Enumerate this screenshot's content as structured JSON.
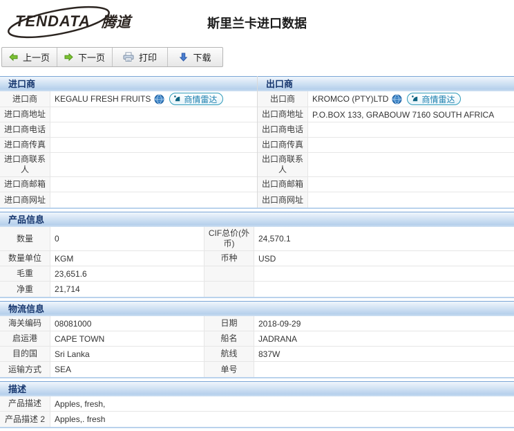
{
  "brand": {
    "logo_en": "TENDATA",
    "logo_cn": "腾道"
  },
  "page_title": "斯里兰卡进口数据",
  "toolbar": {
    "prev_label": "上一页",
    "next_label": "下一页",
    "print_label": "打印",
    "download_label": "下载"
  },
  "radar_button_label": "商情雷达",
  "importer": {
    "header": "进口商",
    "rows": [
      {
        "label": "进口商",
        "value": "KEGALU FRESH FRUITS"
      },
      {
        "label": "进口商地址",
        "value": ""
      },
      {
        "label": "进口商电话",
        "value": ""
      },
      {
        "label": "进口商传真",
        "value": ""
      },
      {
        "label": "进口商联系人",
        "value": ""
      },
      {
        "label": "进口商邮箱",
        "value": ""
      },
      {
        "label": "进口商网址",
        "value": ""
      }
    ]
  },
  "exporter": {
    "header": "出口商",
    "rows": [
      {
        "label": "出口商",
        "value": "KROMCO (PTY)LTD"
      },
      {
        "label": "出口商地址",
        "value": "P.O.BOX 133, GRABOUW 7160 SOUTH AFRICA"
      },
      {
        "label": "出口商电话",
        "value": ""
      },
      {
        "label": "出口商传真",
        "value": ""
      },
      {
        "label": "出口商联系人",
        "value": ""
      },
      {
        "label": "出口商邮箱",
        "value": ""
      },
      {
        "label": "出口商网址",
        "value": ""
      }
    ]
  },
  "product": {
    "header": "产品信息",
    "rows": [
      {
        "label1": "数量",
        "value1": "0",
        "label2": "CIF总价(外币)",
        "value2": "24,570.1"
      },
      {
        "label1": "数量单位",
        "value1": "KGM",
        "label2": "币种",
        "value2": "USD"
      },
      {
        "label1": "毛重",
        "value1": "23,651.6",
        "label2": "",
        "value2": ""
      },
      {
        "label1": "净重",
        "value1": "21,714",
        "label2": "",
        "value2": ""
      }
    ]
  },
  "logistics": {
    "header": "物流信息",
    "rows": [
      {
        "label1": "海关编码",
        "value1": "08081000",
        "label2": "日期",
        "value2": "2018-09-29"
      },
      {
        "label1": "启运港",
        "value1": "CAPE TOWN",
        "label2": "船名",
        "value2": "JADRANA"
      },
      {
        "label1": "目的国",
        "value1": "Sri Lanka",
        "label2": "航线",
        "value2": "837W"
      },
      {
        "label1": "运输方式",
        "value1": "SEA",
        "label2": "单号",
        "value2": ""
      }
    ]
  },
  "description": {
    "header": "描述",
    "rows": [
      {
        "label": "产品描述",
        "value": "Apples, fresh,"
      },
      {
        "label": "产品描述 2",
        "value": "Apples,. fresh"
      }
    ]
  },
  "colors": {
    "section_header_text": "#16366e",
    "section_header_top": "#f0f6fc",
    "section_header_bottom": "#b6d0ec",
    "section_divider": "#b9d2ec",
    "radar_accent": "#1d7fae",
    "arrow_green": "#7cc133",
    "download_blue": "#4a7ed0"
  }
}
